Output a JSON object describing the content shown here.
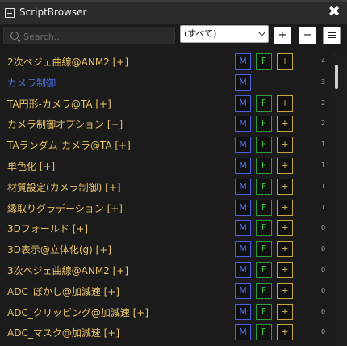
{
  "window": {
    "title": "ScriptBrowser",
    "close_label": "✖"
  },
  "toolbar": {
    "search_placeholder": "Search...",
    "filter_value": "(すべて)",
    "add_label": "+",
    "remove_label": "−"
  },
  "button_labels": {
    "m": "M",
    "f": "F",
    "add": "+"
  },
  "rows": [
    {
      "name": "2次ベジェ曲線@ANM2 [+]",
      "count": "4",
      "f": true,
      "color": "#e8c267"
    },
    {
      "name": "カメラ制御",
      "count": "3",
      "f": false,
      "color": "#4b70e0"
    },
    {
      "name": "TA円形-カメラ@TA [+]",
      "count": "2",
      "f": true,
      "color": "#e8c267"
    },
    {
      "name": "カメラ制御オプション [+]",
      "count": "2",
      "f": true,
      "color": "#e8c267"
    },
    {
      "name": "TAランダム-カメラ@TA [+]",
      "count": "1",
      "f": true,
      "color": "#e8c267"
    },
    {
      "name": "単色化 [+]",
      "count": "1",
      "f": true,
      "color": "#e8c267"
    },
    {
      "name": "材質設定(カメラ制御) [+]",
      "count": "1",
      "f": true,
      "color": "#e8c267"
    },
    {
      "name": "縁取りグラデーション [+]",
      "count": "1",
      "f": true,
      "color": "#e8c267"
    },
    {
      "name": "3Dフォールド [+]",
      "count": "0",
      "f": true,
      "color": "#e8c267"
    },
    {
      "name": "3D表示@立体化(g) [+]",
      "count": "0",
      "f": true,
      "color": "#e8c267"
    },
    {
      "name": "3次ベジェ曲線@ANM2 [+]",
      "count": "0",
      "f": true,
      "color": "#e8c267"
    },
    {
      "name": "ADC_ぼかし@加減速 [+]",
      "count": "0",
      "f": true,
      "color": "#e8c267"
    },
    {
      "name": "ADC_クリッピング@加減速 [+]",
      "count": "0",
      "f": true,
      "color": "#e8c267"
    },
    {
      "name": "ADC_マスク@加減速 [+]",
      "count": "0",
      "f": true,
      "color": "#e8c267"
    }
  ]
}
